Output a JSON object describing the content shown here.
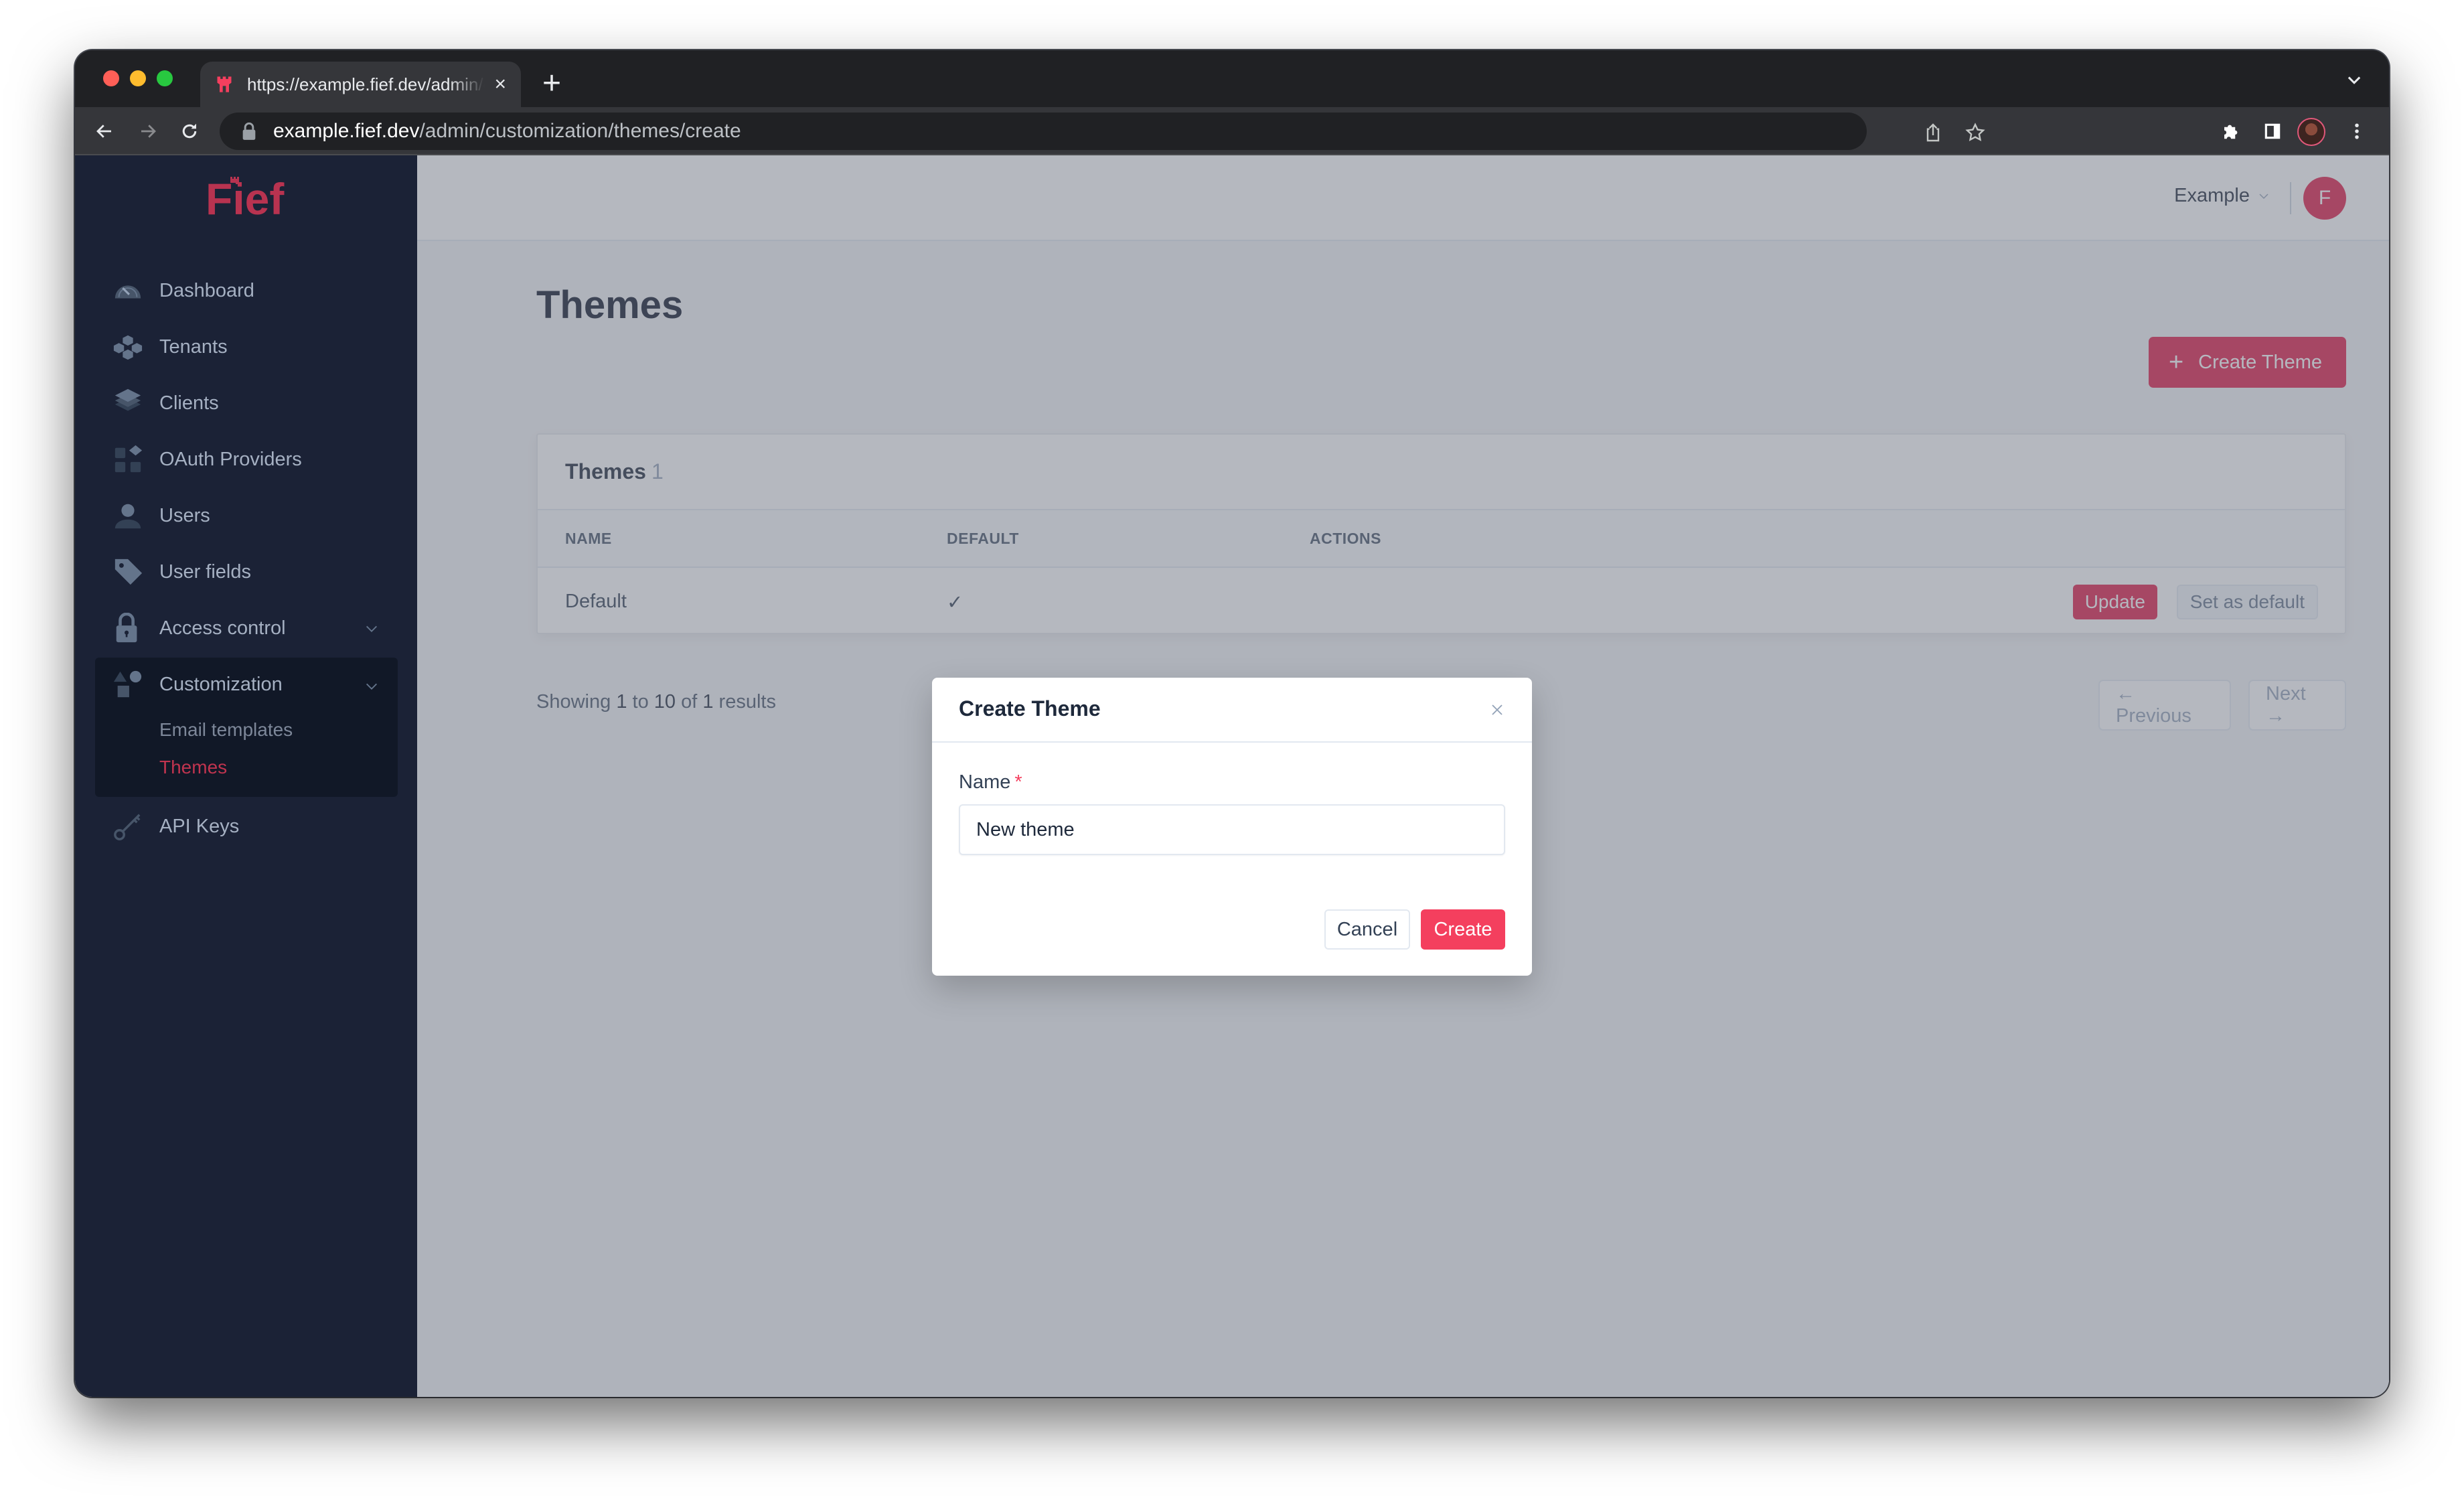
{
  "browser": {
    "tab_title": "https://example.fief.dev/admin/customization/themes/create",
    "tab_close": "×",
    "new_tab": "+",
    "url_host": "example.fief.dev",
    "url_path": "/admin/customization/themes/create"
  },
  "sidebar": {
    "logo": "Fief",
    "items": [
      {
        "label": "Dashboard",
        "icon": "dashboard-gauge-icon"
      },
      {
        "label": "Tenants",
        "icon": "tenants-cubes-icon"
      },
      {
        "label": "Clients",
        "icon": "clients-layers-icon"
      },
      {
        "label": "OAuth Providers",
        "icon": "oauth-providers-grid-icon"
      },
      {
        "label": "Users",
        "icon": "user-icon"
      },
      {
        "label": "User fields",
        "icon": "tag-icon"
      },
      {
        "label": "Access control",
        "icon": "lock-icon",
        "expandable": true
      },
      {
        "label": "Customization",
        "icon": "shapes-icon",
        "expandable": true,
        "expanded": true,
        "children": [
          {
            "label": "Email templates",
            "active": false
          },
          {
            "label": "Themes",
            "active": true
          }
        ]
      },
      {
        "label": "API Keys",
        "icon": "key-icon"
      }
    ]
  },
  "topbar": {
    "tenant": "Example",
    "avatar_initial": "F"
  },
  "main": {
    "title": "Themes",
    "create_button": "Create Theme",
    "card": {
      "title": "Themes",
      "count": "1",
      "columns": [
        "NAME",
        "DEFAULT",
        "ACTIONS"
      ],
      "rows": [
        {
          "name": "Default",
          "default": "✓",
          "actions": [
            "Update",
            "Set as default"
          ]
        }
      ]
    },
    "pagination": {
      "prefix": "Showing",
      "from": "1",
      "to_word": "to",
      "to": "10",
      "of_word": "of",
      "total": "1",
      "suffix": "results",
      "previous": "← Previous",
      "next": "Next →"
    }
  },
  "modal": {
    "title": "Create Theme",
    "field_label": "Name",
    "required_mark": "*",
    "name_value": "New theme",
    "cancel": "Cancel",
    "create": "Create"
  },
  "colors": {
    "accent": "#e11d48",
    "modal_primary": "#f43f5e",
    "sidebar_bg": "#1b2236"
  }
}
